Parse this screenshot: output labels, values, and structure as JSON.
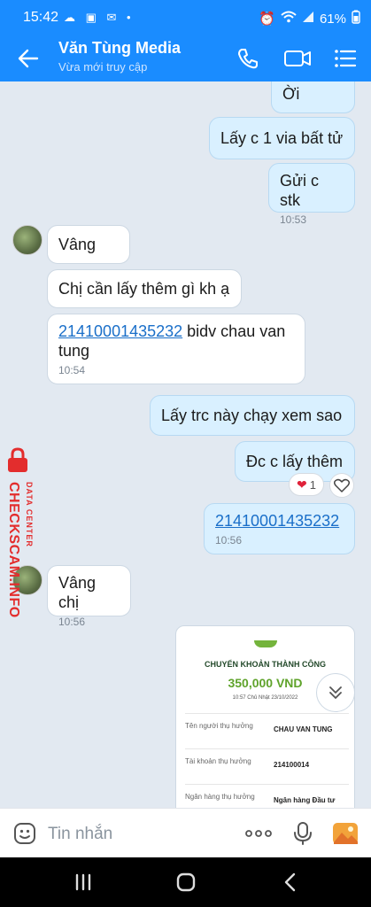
{
  "status_bar": {
    "time": "15:42",
    "battery": "61%"
  },
  "header": {
    "contact_name": "Văn Tùng Media",
    "presence": "Vừa mới truy cập"
  },
  "messages": [
    {
      "side": "me",
      "text": "Ời"
    },
    {
      "side": "me",
      "text": "Lấy c 1 via bất tử"
    },
    {
      "side": "me",
      "text": "Gửi c stk",
      "time": "10:53"
    },
    {
      "side": "them",
      "text": "Vâng"
    },
    {
      "side": "them",
      "text": "Chị cần lấy thêm gì kh ạ"
    },
    {
      "side": "them",
      "link": "21410001435232",
      "text": " bidv chau van tung",
      "time": "10:54"
    },
    {
      "side": "me",
      "text": "Lấy trc này chạy xem sao"
    },
    {
      "side": "me",
      "text": "Đc c lấy thêm",
      "reaction_count": "1"
    },
    {
      "side": "me",
      "link": "21410001435232",
      "time": "10:56"
    },
    {
      "side": "them",
      "text": "Vâng chị",
      "time": "10:56"
    }
  ],
  "receipt": {
    "title": "CHUYỂN KHOẢN THÀNH CÔNG",
    "amount": "350,000 VND",
    "datetime": "10:57 Chủ Nhật 23/10/2022",
    "rows": [
      {
        "label": "Tên người thụ hưởng",
        "value": "CHAU VAN TUNG"
      },
      {
        "label": "Tài khoản thụ hưởng",
        "value": "214100014"
      },
      {
        "label": "Ngân hàng thụ hưởng",
        "value": "Ngân hàng Đầu tư"
      }
    ]
  },
  "watermark": {
    "main": "CHECKSCAM.INFO",
    "sub": "DATA CENTER"
  },
  "input": {
    "placeholder": "Tin nhắn"
  },
  "colors": {
    "brand": "#1a8cff",
    "my_bubble": "#d9f0ff",
    "their_bubble": "#ffffff",
    "link": "#1a6fc9",
    "watermark": "#e32d2d",
    "receipt_amount": "#5fa32b"
  }
}
